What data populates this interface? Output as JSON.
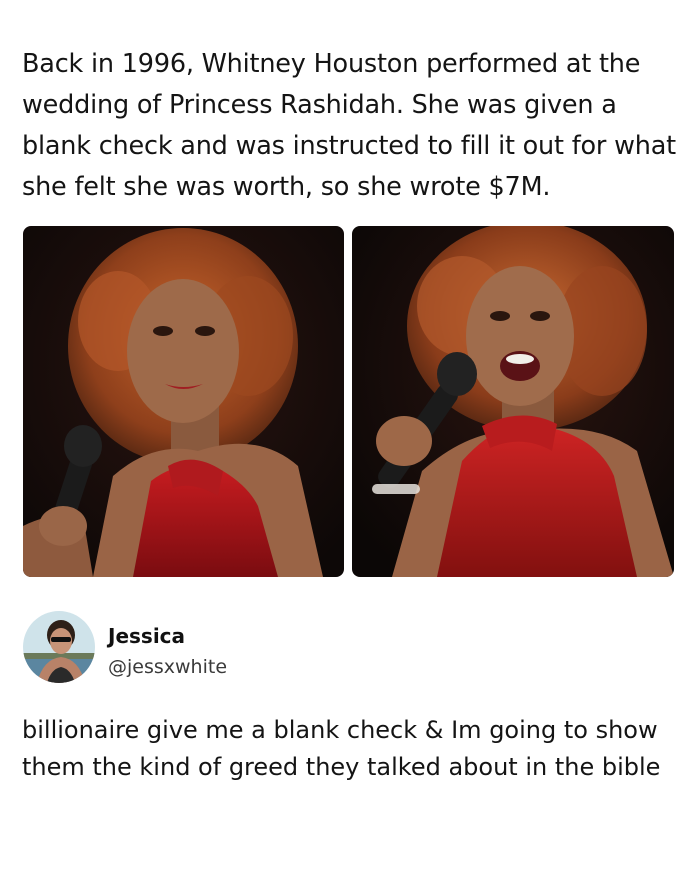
{
  "post": {
    "headline": "Back in 1996, Whitney Houston performed at the wedding of Princess Rashidah. She was given a blank check and was instructed to fill it out for what she felt she was worth, so she wrote $7M."
  },
  "photos": [
    {
      "icon": "singer-photo-icon"
    },
    {
      "icon": "singer-photo-icon"
    }
  ],
  "tweet": {
    "display_name": "Jessica",
    "handle": "@jessxwhite",
    "text": "billionaire give me a blank check & Im going to show them the kind of greed they talked about in the bible"
  },
  "colors": {
    "text": "#141414",
    "dress_red": "#b0141a",
    "hair_auburn": "#a24a22",
    "photo_bg": "#120c0a"
  }
}
